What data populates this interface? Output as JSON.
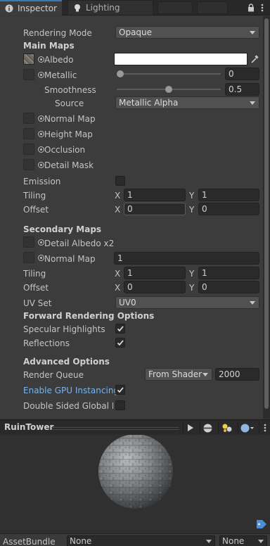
{
  "tabs": {
    "inspector": "Inspector",
    "lighting": "Lighting"
  },
  "fields": {
    "rendering_mode": {
      "label": "Rendering Mode",
      "value": "Opaque"
    },
    "main_maps": "Main Maps",
    "albedo": "Albedo",
    "metallic": {
      "label": "Metallic",
      "value": "0",
      "fraction": 0
    },
    "smoothness": {
      "label": "Smoothness",
      "value": "0.5",
      "fraction": 0.5
    },
    "source": {
      "label": "Source",
      "value": "Metallic Alpha"
    },
    "normal_map": "Normal Map",
    "height_map": "Height Map",
    "occlusion": "Occlusion",
    "detail_mask": "Detail Mask",
    "emission": "Emission",
    "tiling1": {
      "label": "Tiling",
      "x_label": "X",
      "x": "1",
      "y_label": "Y",
      "y": "1"
    },
    "offset1": {
      "label": "Offset",
      "x_label": "X",
      "x": "0",
      "y_label": "Y",
      "y": "0"
    },
    "secondary_maps": "Secondary Maps",
    "detail_albedo": "Detail Albedo x2",
    "normal_map2": {
      "label": "Normal Map",
      "value": "1"
    },
    "tiling2": {
      "label": "Tiling",
      "x_label": "X",
      "x": "1",
      "y_label": "Y",
      "y": "1"
    },
    "offset2": {
      "label": "Offset",
      "x_label": "X",
      "x": "0",
      "y_label": "Y",
      "y": "0"
    },
    "uv_set": {
      "label": "UV Set",
      "value": "UV0"
    },
    "forward_options": "Forward Rendering Options",
    "specular_highlights": {
      "label": "Specular Highlights",
      "checked": true
    },
    "reflections": {
      "label": "Reflections",
      "checked": true
    },
    "advanced_options": "Advanced Options",
    "render_queue": {
      "label": "Render Queue",
      "mode": "From Shader",
      "value": "2000"
    },
    "gpu_instancing": {
      "label": "Enable GPU Instancing",
      "checked": true
    },
    "double_sided": {
      "label": "Double Sided Global Illu",
      "checked": false
    }
  },
  "preview": {
    "title": "RuinTower"
  },
  "assetbundle": {
    "label": "AssetBundle",
    "name": "None",
    "variant": "None"
  },
  "colors": {
    "accent": "#3a79bb",
    "link_blue": "#7ab3ee",
    "panel": "#3c3c3c"
  },
  "icons": [
    "info-icon",
    "lightbulb-icon",
    "lock-icon",
    "kebab-menu-icon",
    "target-icon",
    "eyedropper-icon",
    "checkmark-icon",
    "play-icon",
    "sphere-icon",
    "lights-icon",
    "tag-icon"
  ]
}
